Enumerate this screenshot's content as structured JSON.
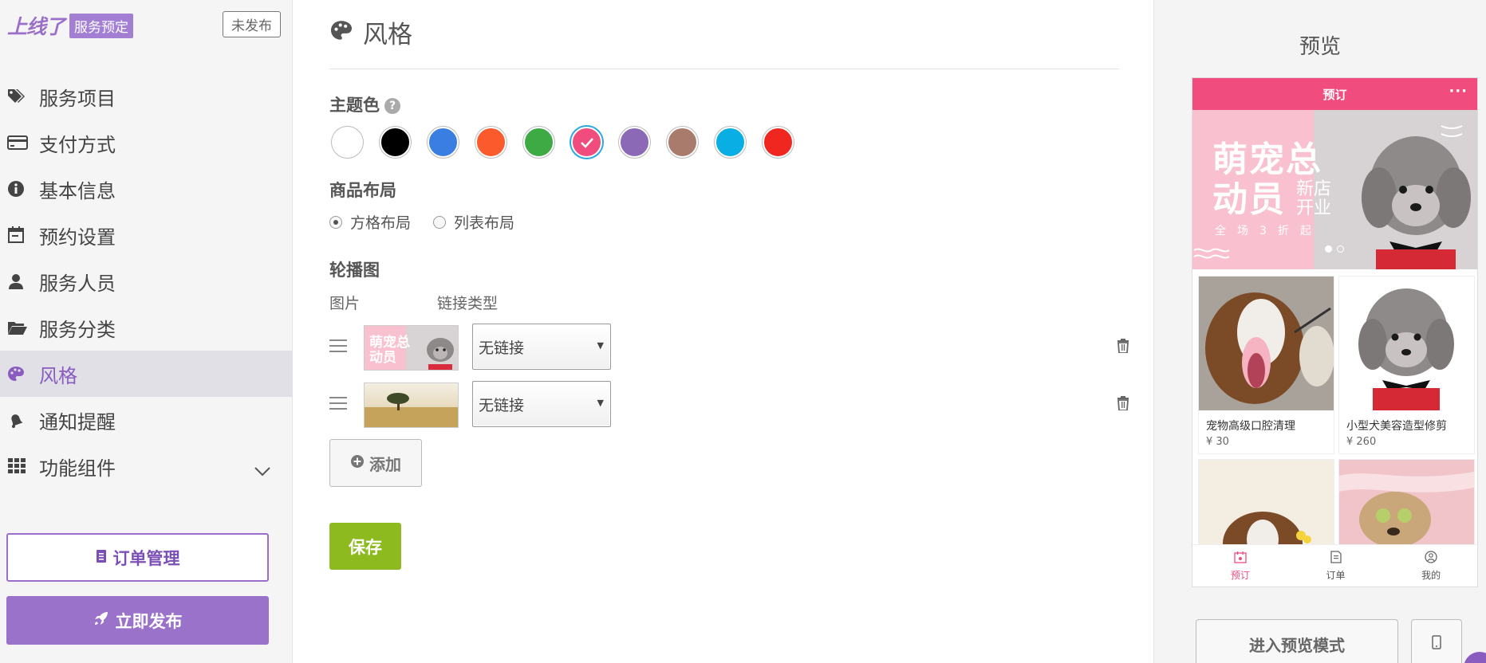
{
  "brand": {
    "logo": "上线了",
    "badge": "服务预定",
    "status": "未发布"
  },
  "sidebar": {
    "items": [
      {
        "label": "服务项目",
        "icon": "tags-icon"
      },
      {
        "label": "支付方式",
        "icon": "credit-card-icon"
      },
      {
        "label": "基本信息",
        "icon": "info-circle-icon"
      },
      {
        "label": "预约设置",
        "icon": "calendar-icon"
      },
      {
        "label": "服务人员",
        "icon": "user-icon"
      },
      {
        "label": "服务分类",
        "icon": "folder-open-icon"
      },
      {
        "label": "风格",
        "icon": "palette-icon",
        "active": true
      },
      {
        "label": "通知提醒",
        "icon": "bell-icon"
      },
      {
        "label": "功能组件",
        "icon": "grid-icon",
        "expandable": true
      }
    ],
    "order_button": "订单管理",
    "publish_button": "立即发布"
  },
  "main": {
    "title": "风格",
    "theme_label": "主题色",
    "theme_colors": [
      "#ffffff",
      "#000000",
      "#3b7ee2",
      "#fb5a2c",
      "#3daa43",
      "#f04c7d",
      "#8b69b6",
      "#a97b6c",
      "#08aee4",
      "#f02720"
    ],
    "selected_color": "#f04c7d",
    "layout_label": "商品布局",
    "layout_options": [
      "方格布局",
      "列表布局"
    ],
    "layout_selected": "方格布局",
    "carousel_label": "轮播图",
    "col_image": "图片",
    "col_link": "链接类型",
    "banners": [
      {
        "link": "无链接"
      },
      {
        "link": "无链接"
      }
    ],
    "add_button": "添加",
    "save_button": "保存"
  },
  "preview": {
    "title": "预览",
    "header": "预订",
    "more": "···",
    "banner_title": "萌宠总动员",
    "banner_title_line1": "萌宠总",
    "banner_title_line2": "动员",
    "banner_sub1": "新店",
    "banner_sub2": "开业",
    "banner_promo": "全场3折起",
    "products": [
      {
        "name": "宠物高级口腔清理",
        "price": "¥ 30"
      },
      {
        "name": "小型犬美容造型修剪",
        "price": "¥ 260"
      },
      {
        "name": "",
        "price": ""
      },
      {
        "name": "",
        "price": ""
      }
    ],
    "tabs": [
      "预订",
      "订单",
      "我的"
    ],
    "enter_button": "进入预览模式"
  }
}
